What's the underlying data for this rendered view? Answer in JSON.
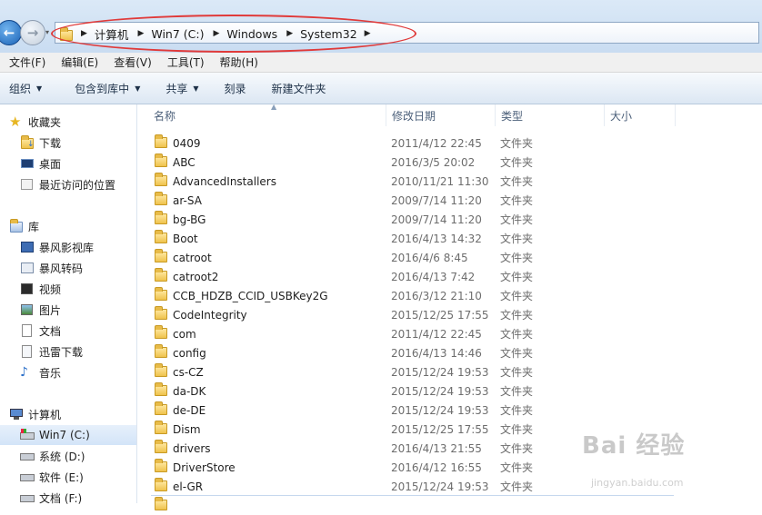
{
  "address": {
    "crumbs": [
      "计算机",
      "Win7 (C:)",
      "Windows",
      "System32"
    ]
  },
  "menu": [
    "文件(F)",
    "编辑(E)",
    "查看(V)",
    "工具(T)",
    "帮助(H)"
  ],
  "toolbar": {
    "organize": "组织",
    "include_library": "包含到库中",
    "share": "共享",
    "burn": "刻录",
    "new_folder": "新建文件夹"
  },
  "nav": {
    "favorites_header": "收藏夹",
    "favorites": [
      "下载",
      "桌面",
      "最近访问的位置"
    ],
    "libraries_header": "库",
    "libraries": [
      "暴风影视库",
      "暴风转码",
      "视频",
      "图片",
      "文档",
      "迅雷下载",
      "音乐"
    ],
    "computer_header": "计算机",
    "drives": [
      "Win7 (C:)",
      "系统 (D:)",
      "软件 (E:)",
      "文档 (F:)"
    ]
  },
  "columns": {
    "name": "名称",
    "date": "修改日期",
    "type": "类型",
    "size": "大小"
  },
  "files": [
    {
      "name": "0409",
      "date": "2011/4/12 22:45",
      "type": "文件夹"
    },
    {
      "name": "ABC",
      "date": "2016/3/5 20:02",
      "type": "文件夹"
    },
    {
      "name": "AdvancedInstallers",
      "date": "2010/11/21 11:30",
      "type": "文件夹"
    },
    {
      "name": "ar-SA",
      "date": "2009/7/14 11:20",
      "type": "文件夹"
    },
    {
      "name": "bg-BG",
      "date": "2009/7/14 11:20",
      "type": "文件夹"
    },
    {
      "name": "Boot",
      "date": "2016/4/13 14:32",
      "type": "文件夹"
    },
    {
      "name": "catroot",
      "date": "2016/4/6 8:45",
      "type": "文件夹"
    },
    {
      "name": "catroot2",
      "date": "2016/4/13 7:42",
      "type": "文件夹"
    },
    {
      "name": "CCB_HDZB_CCID_USBKey2G",
      "date": "2016/3/12 21:10",
      "type": "文件夹"
    },
    {
      "name": "CodeIntegrity",
      "date": "2015/12/25 17:55",
      "type": "文件夹"
    },
    {
      "name": "com",
      "date": "2011/4/12 22:45",
      "type": "文件夹"
    },
    {
      "name": "config",
      "date": "2016/4/13 14:46",
      "type": "文件夹"
    },
    {
      "name": "cs-CZ",
      "date": "2015/12/24 19:53",
      "type": "文件夹"
    },
    {
      "name": "da-DK",
      "date": "2015/12/24 19:53",
      "type": "文件夹"
    },
    {
      "name": "de-DE",
      "date": "2015/12/24 19:53",
      "type": "文件夹"
    },
    {
      "name": "Dism",
      "date": "2015/12/25 17:55",
      "type": "文件夹"
    },
    {
      "name": "drivers",
      "date": "2016/4/13 21:55",
      "type": "文件夹"
    },
    {
      "name": "DriverStore",
      "date": "2016/4/12 16:55",
      "type": "文件夹"
    },
    {
      "name": "el-GR",
      "date": "2015/12/24 19:53",
      "type": "文件夹"
    }
  ],
  "watermark": {
    "brand": "Bai 经验",
    "url": "jingyan.baidu.com"
  },
  "colors": {
    "highlight_oval": "#e03a3a",
    "selected_bg": "#d3e4f8"
  }
}
